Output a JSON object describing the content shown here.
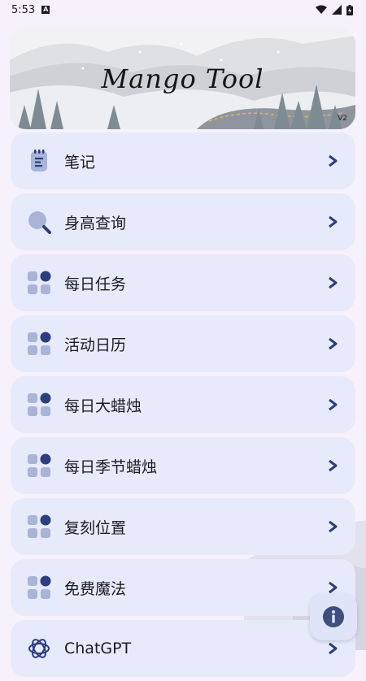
{
  "status_bar": {
    "time": "5:53",
    "notification_icon": "text-a-icon",
    "icons": [
      "wifi-icon",
      "signal-icon",
      "battery-icon"
    ]
  },
  "banner": {
    "title": "Mango Tool",
    "version": "V2"
  },
  "menu": [
    {
      "label": "笔记",
      "icon": "notebook-icon"
    },
    {
      "label": "身高查询",
      "icon": "search-icon"
    },
    {
      "label": "每日任务",
      "icon": "grid-icon"
    },
    {
      "label": "活动日历",
      "icon": "grid-icon"
    },
    {
      "label": "每日大蜡烛",
      "icon": "grid-icon"
    },
    {
      "label": "每日季节蜡烛",
      "icon": "grid-icon"
    },
    {
      "label": "复刻位置",
      "icon": "grid-icon"
    },
    {
      "label": "免费魔法",
      "icon": "grid-icon"
    },
    {
      "label": "ChatGPT",
      "icon": "openai-icon"
    }
  ],
  "fab": {
    "icon": "info-icon"
  },
  "colors": {
    "item_bg": "#e7eafb",
    "icon_dark": "#2c3e7c",
    "icon_light": "#a9b4d6"
  }
}
